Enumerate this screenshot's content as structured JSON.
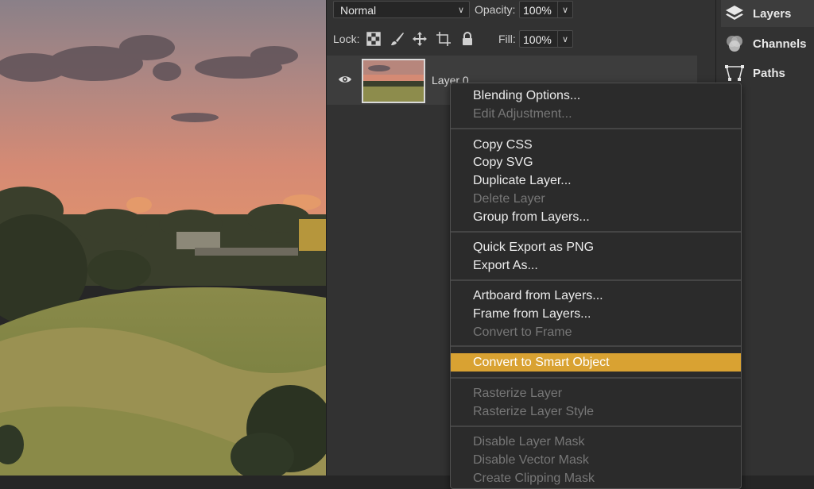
{
  "toolbar": {
    "blend_mode": "Normal",
    "opacity_label": "Opacity:",
    "opacity_value": "100%",
    "lock_label": "Lock:",
    "fill_label": "Fill:",
    "fill_value": "100%",
    "lock_icons": [
      "transparent-pixels-icon",
      "brush-icon",
      "move-icon",
      "artboard-icon",
      "lock-icon"
    ]
  },
  "layer": {
    "name": "Layer 0",
    "visible": true
  },
  "side_tabs": [
    {
      "label": "Layers",
      "icon": "layers-icon"
    },
    {
      "label": "Channels",
      "icon": "channels-icon"
    },
    {
      "label": "Paths",
      "icon": "paths-icon"
    }
  ],
  "menu": {
    "items": [
      {
        "label": "Blending Options...",
        "enabled": true
      },
      {
        "label": "Edit Adjustment...",
        "enabled": false
      },
      {
        "label": "Copy CSS",
        "enabled": true
      },
      {
        "label": "Copy SVG",
        "enabled": true
      },
      {
        "label": "Duplicate Layer...",
        "enabled": true
      },
      {
        "label": "Delete Layer",
        "enabled": false
      },
      {
        "label": "Group from Layers...",
        "enabled": true
      },
      {
        "label": "Quick Export as PNG",
        "enabled": true
      },
      {
        "label": "Export As...",
        "enabled": true
      },
      {
        "label": "Artboard from Layers...",
        "enabled": true
      },
      {
        "label": "Frame from Layers...",
        "enabled": true
      },
      {
        "label": "Convert to Frame",
        "enabled": false
      },
      {
        "label": "Convert to Smart Object",
        "enabled": true,
        "highlighted": true
      },
      {
        "label": "Rasterize Layer",
        "enabled": false
      },
      {
        "label": "Rasterize Layer Style",
        "enabled": false
      },
      {
        "label": "Disable Layer Mask",
        "enabled": false
      },
      {
        "label": "Disable Vector Mask",
        "enabled": false
      },
      {
        "label": "Create Clipping Mask",
        "enabled": false
      }
    ]
  },
  "colors": {
    "panel_bg": "#323232",
    "menu_bg": "#2b2b2b",
    "highlight": "#d9a232",
    "disabled_text": "#777777"
  }
}
